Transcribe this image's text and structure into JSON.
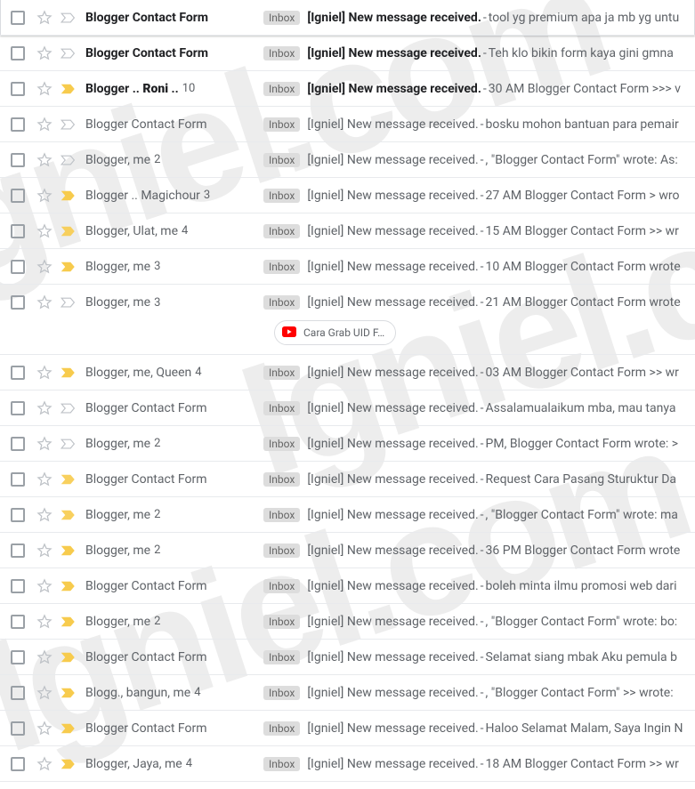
{
  "inbox_label": "Inbox",
  "watermark_text": "Igniel.com",
  "chip": {
    "label": "Cara Grab UID F…"
  },
  "rows": [
    {
      "unread": true,
      "imp": "none",
      "sender": "Blogger Contact Form",
      "count": "",
      "subject": "[Igniel] New message received.",
      "snippet": "tool yg premium apa ja mb yg untu"
    },
    {
      "unread": true,
      "imp": "none",
      "sender": "Blogger Contact Form",
      "count": "",
      "subject": "[Igniel] New message received.",
      "snippet": "Teh klo bikin form kaya gini gmna"
    },
    {
      "unread": true,
      "imp": "yellow",
      "sender_html": "Blogger .. <b>Roni</b> ..",
      "count": "10",
      "subject": "[Igniel] New message received.",
      "snippet": "30 AM Blogger Contact Form >>> v"
    },
    {
      "unread": false,
      "imp": "none",
      "sender": "Blogger Contact Form",
      "count": "",
      "subject": "[Igniel] New message received.",
      "snippet": "bosku mohon bantuan para pemair"
    },
    {
      "unread": false,
      "imp": "none",
      "sender": "Blogger, me",
      "count": "2",
      "subject": "[Igniel] New message received.",
      "snippet": ", \"Blogger Contact Form\" wrote: As:"
    },
    {
      "unread": false,
      "imp": "yellow",
      "sender": "Blogger .. Magichour",
      "count": "3",
      "subject": "[Igniel] New message received.",
      "snippet": "27 AM Blogger Contact Form > wro"
    },
    {
      "unread": false,
      "imp": "dotted",
      "sender": "Blogger, Ulat, me",
      "count": "4",
      "subject": "[Igniel] New message received.",
      "snippet": "15 AM Blogger Contact Form >> wr"
    },
    {
      "unread": false,
      "imp": "yellow",
      "sender": "Blogger, me",
      "count": "3",
      "subject": "[Igniel] New message received.",
      "snippet": "10 AM Blogger Contact Form wrote"
    },
    {
      "unread": false,
      "imp": "none",
      "sender": "Blogger, me",
      "count": "3",
      "subject": "[Igniel] New message received.",
      "snippet": "21 AM Blogger Contact Form wrote",
      "has_chip": true
    },
    {
      "unread": false,
      "imp": "yellow",
      "sender": "Blogger, me, Queen",
      "count": "4",
      "subject": "[Igniel] New message received.",
      "snippet": "03 AM Blogger Contact Form >> wr"
    },
    {
      "unread": false,
      "imp": "none",
      "sender": "Blogger Contact Form",
      "count": "",
      "subject": "[Igniel] New message received.",
      "snippet": "Assalamualaikum mba, mau tanya"
    },
    {
      "unread": false,
      "imp": "none",
      "sender": "Blogger, me",
      "count": "2",
      "subject": "[Igniel] New message received.",
      "snippet": "PM, Blogger Contact Form wrote: >"
    },
    {
      "unread": false,
      "imp": "dotted",
      "sender": "Blogger Contact Form",
      "count": "",
      "subject": "[Igniel] New message received.",
      "snippet": "Request Cara Pasang Sturuktur Da"
    },
    {
      "unread": false,
      "imp": "dotted",
      "sender": "Blogger, me",
      "count": "2",
      "subject": "[Igniel] New message received.",
      "snippet": ", \"Blogger Contact Form\" wrote: ma"
    },
    {
      "unread": false,
      "imp": "yellow",
      "sender": "Blogger, me",
      "count": "2",
      "subject": "[Igniel] New message received.",
      "snippet": "36 PM Blogger Contact Form wrote"
    },
    {
      "unread": false,
      "imp": "yellow",
      "sender": "Blogger Contact Form",
      "count": "",
      "subject": "[Igniel] New message received.",
      "snippet": "boleh minta ilmu promosi web dari"
    },
    {
      "unread": false,
      "imp": "yellow",
      "sender": "Blogger, me",
      "count": "2",
      "subject": "[Igniel] New message received.",
      "snippet": ", \"Blogger Contact Form\" wrote: bo:"
    },
    {
      "unread": false,
      "imp": "yellow",
      "sender": "Blogger Contact Form",
      "count": "",
      "subject": "[Igniel] New message received.",
      "snippet": "Selamat siang mbak Aku pemula b"
    },
    {
      "unread": false,
      "imp": "yellow",
      "sender": "Blogg., bangun, me",
      "count": "4",
      "subject": "[Igniel] New message received.",
      "snippet": ", \"Blogger Contact Form\" >> wrote:"
    },
    {
      "unread": false,
      "imp": "yellow",
      "sender": "Blogger Contact Form",
      "count": "",
      "subject": "[Igniel] New message received.",
      "snippet": "Haloo Selamat Malam, Saya Ingin N"
    },
    {
      "unread": false,
      "imp": "yellow",
      "sender": "Blogger, Jaya, me",
      "count": "4",
      "subject": "[Igniel] New message received.",
      "snippet": "18 AM Blogger Contact Form >> wr"
    }
  ]
}
